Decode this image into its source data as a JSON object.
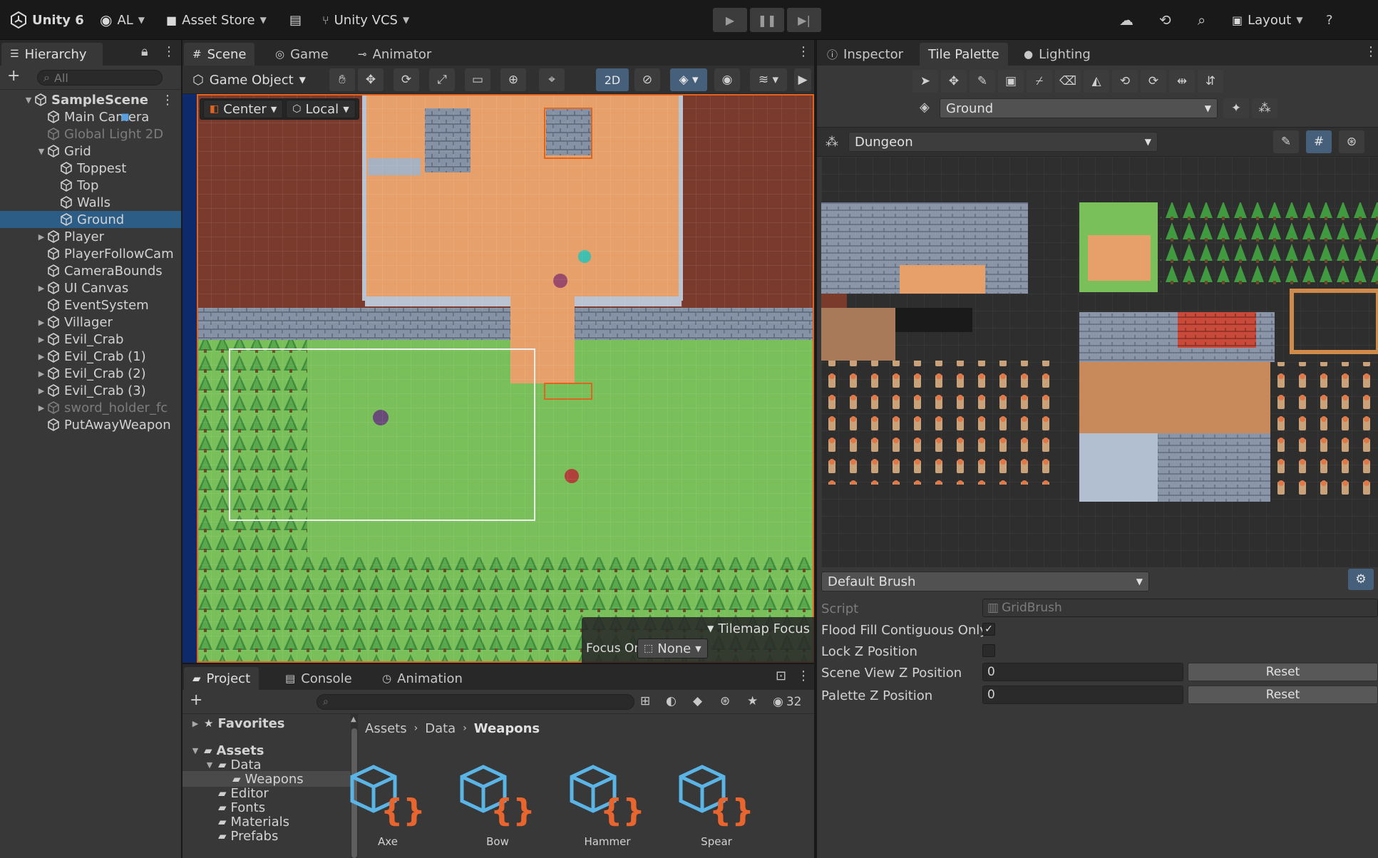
{
  "app": {
    "title": "Unity 6",
    "account": "AL",
    "asset_store": "Asset Store",
    "vcs": "Unity VCS",
    "layout": "Layout"
  },
  "colors": {
    "accent": "#2c5d87",
    "panel": "#383838",
    "tab_bar": "#282828",
    "toolbar": "#191919",
    "scene_border": "#e0641e",
    "grass": "#79c05a",
    "sand": "#e7a06a",
    "dirt": "#7a3a2c",
    "stone": "#8a96a8"
  },
  "hierarchy": {
    "tab": "Hierarchy",
    "search_placeholder": "All",
    "rows": [
      {
        "label": "SampleScene"
      },
      {
        "label": "Main Camera"
      },
      {
        "label": "Global Light 2D"
      },
      {
        "label": "Grid"
      },
      {
        "label": "Toppest"
      },
      {
        "label": "Top"
      },
      {
        "label": "Walls"
      },
      {
        "label": "Ground"
      },
      {
        "label": "Player"
      },
      {
        "label": "PlayerFollowCam"
      },
      {
        "label": "CameraBounds"
      },
      {
        "label": "UI Canvas"
      },
      {
        "label": "EventSystem"
      },
      {
        "label": "Villager"
      },
      {
        "label": "Evil_Crab"
      },
      {
        "label": "Evil_Crab (1)"
      },
      {
        "label": "Evil_Crab (2)"
      },
      {
        "label": "Evil_Crab (3)"
      },
      {
        "label": "sword_holder_fc"
      },
      {
        "label": "PutAwayWeapon"
      }
    ]
  },
  "scene": {
    "tabs": [
      {
        "label": "Scene"
      },
      {
        "label": "Game"
      },
      {
        "label": "Animator"
      }
    ],
    "game_object": "Game Object",
    "mode_2d": "2D",
    "pivot": "Center",
    "space": "Local",
    "tilemap_focus": {
      "title": "Tilemap Focus",
      "label": "Focus On",
      "value": "None"
    }
  },
  "project": {
    "tabs": [
      {
        "label": "Project"
      },
      {
        "label": "Console"
      },
      {
        "label": "Animation"
      }
    ],
    "hidden_count": "32",
    "breadcrumb": [
      "Assets",
      "Data",
      "Weapons"
    ],
    "tree": [
      {
        "label": "Favorites"
      },
      {
        "label": "Assets"
      },
      {
        "label": "Data"
      },
      {
        "label": "Weapons"
      },
      {
        "label": "Editor"
      },
      {
        "label": "Fonts"
      },
      {
        "label": "Materials"
      },
      {
        "label": "Prefabs"
      }
    ],
    "assets": [
      {
        "label": "Axe"
      },
      {
        "label": "Bow"
      },
      {
        "label": "Hammer"
      },
      {
        "label": "Spear"
      }
    ]
  },
  "right": {
    "tabs": [
      {
        "label": "Inspector"
      },
      {
        "label": "Tile Palette"
      },
      {
        "label": "Lighting"
      }
    ],
    "target_tilemap": "Ground",
    "palette": "Dungeon",
    "brush": "Default Brush",
    "fields": {
      "script_label": "Script",
      "script_value": "GridBrush",
      "flood_label": "Flood Fill Contiguous Only",
      "lockz_label": "Lock Z Position",
      "scenez_label": "Scene View Z Position",
      "scenez_value": "0",
      "palettez_label": "Palette Z Position",
      "palettez_value": "0",
      "reset": "Reset"
    }
  }
}
